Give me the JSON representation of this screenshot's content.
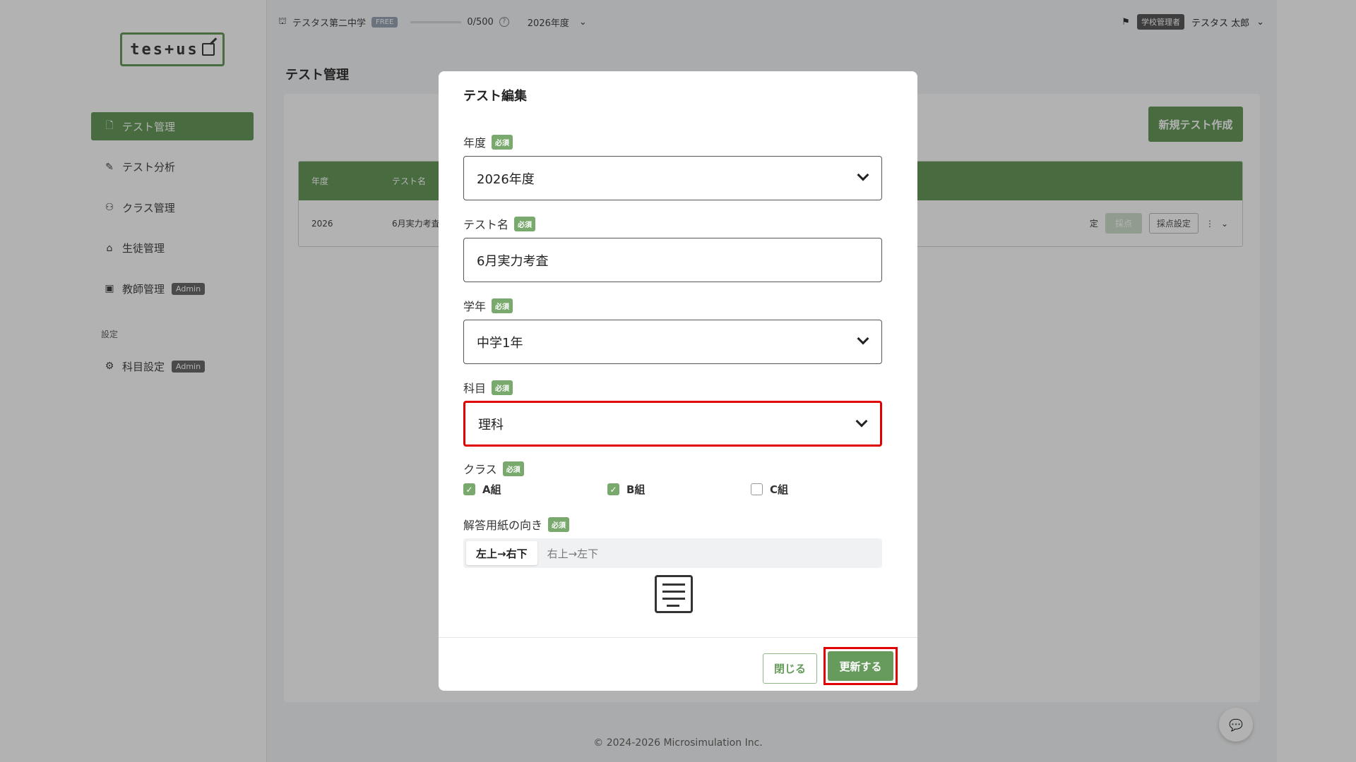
{
  "sidebar": {
    "logo_text": "tes+us",
    "items": [
      {
        "label": "テスト管理",
        "icon": "document-icon"
      },
      {
        "label": "テスト分析",
        "icon": "analysis-icon"
      },
      {
        "label": "クラス管理",
        "icon": "group-icon"
      },
      {
        "label": "生徒管理",
        "icon": "student-cap-icon"
      },
      {
        "label": "教師管理",
        "icon": "teacher-icon",
        "badge": "Admin"
      }
    ],
    "section_label": "設定",
    "settings_items": [
      {
        "label": "科目設定",
        "icon": "gear-icon",
        "badge": "Admin"
      }
    ]
  },
  "topbar": {
    "school_name": "テスタス第二中学",
    "plan_tag": "FREE",
    "usage": "0/500",
    "year": "2026年度",
    "role_tag": "学校管理者",
    "user_name": "テスタス 太郎"
  },
  "page": {
    "title": "テスト管理",
    "new_test_button": "新規テスト作成",
    "table_headers": [
      "年度",
      "テスト名"
    ],
    "row": {
      "year": "2026",
      "name": "6月実力考査",
      "status_partial": "定",
      "grade_button": "採点",
      "grade_settings_button": "採点設定"
    }
  },
  "footer": "© 2024-2026 Microsimulation Inc.",
  "modal": {
    "title": "テスト編集",
    "required_tag": "必須",
    "year_label": "年度",
    "year_value": "2026年度",
    "name_label": "テスト名",
    "name_value": "6月実力考査",
    "grade_label": "学年",
    "grade_value": "中学1年",
    "subject_label": "科目",
    "subject_value": "理科",
    "class_label": "クラス",
    "classes": [
      {
        "label": "A組",
        "checked": true
      },
      {
        "label": "B組",
        "checked": true
      },
      {
        "label": "C組",
        "checked": false
      }
    ],
    "orientation_label": "解答用紙の向き",
    "orientation_options": [
      "左上→右下",
      "右上→左下"
    ],
    "orientation_selected": "左上→右下",
    "close_button": "閉じる",
    "update_button": "更新する"
  },
  "colors": {
    "accent": "#679b5c",
    "highlight": "#e00000"
  }
}
